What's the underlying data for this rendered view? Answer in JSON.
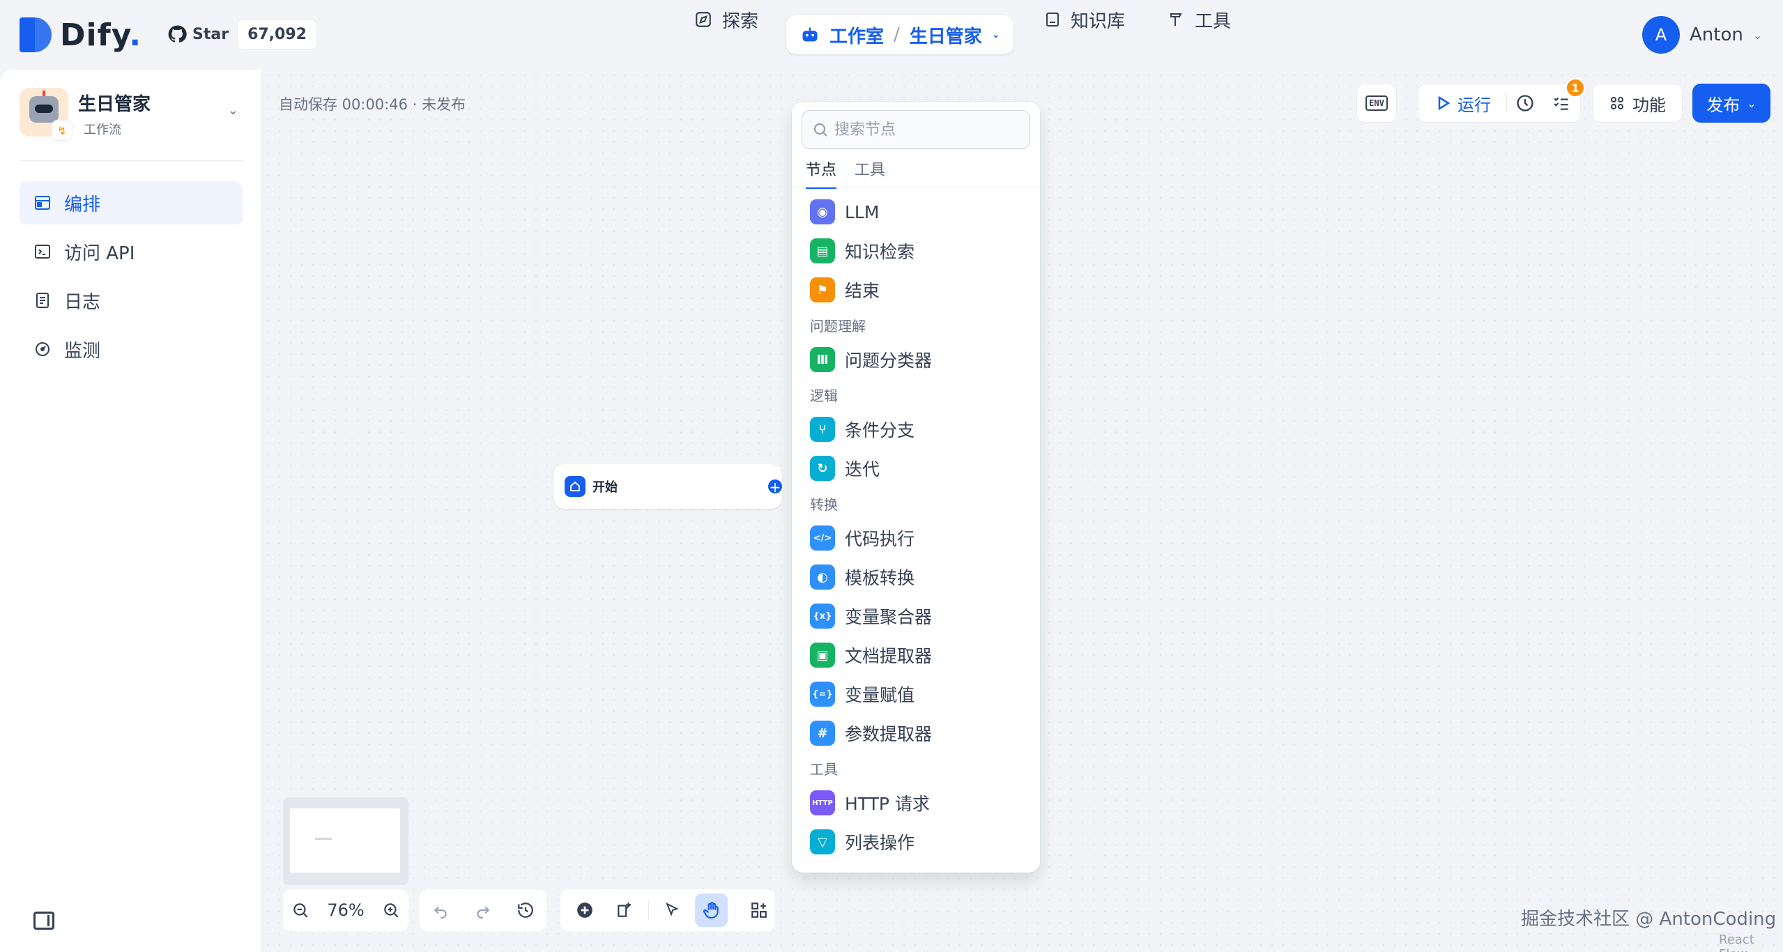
{
  "brand": {
    "name": "Dify",
    "dot": "."
  },
  "github": {
    "star_label": "Star",
    "count": "67,092"
  },
  "nav": {
    "explore": "探索",
    "studio": "工作室",
    "app": "生日管家",
    "datasets": "知识库",
    "tools": "工具"
  },
  "user": {
    "initial": "A",
    "name": "Anton"
  },
  "app": {
    "name": "生日管家",
    "type": "工作流"
  },
  "sidebar": {
    "items": [
      {
        "label": "编排",
        "icon": "layout-icon",
        "active": true
      },
      {
        "label": "访问 API",
        "icon": "terminal-icon",
        "active": false
      },
      {
        "label": "日志",
        "icon": "file-list-icon",
        "active": false
      },
      {
        "label": "监测",
        "icon": "gauge-icon",
        "active": false
      }
    ]
  },
  "canvas": {
    "autosave": "自动保存 00:00:46 · 未发布",
    "start_node": "开始",
    "zoom": "76%"
  },
  "actions": {
    "env": "ENV",
    "run": "运行",
    "badge": "1",
    "features": "功能",
    "publish": "发布"
  },
  "picker": {
    "search_placeholder": "搜索节点",
    "tabs": [
      "节点",
      "工具"
    ],
    "entries": [
      {
        "kind": "item",
        "label": "LLM",
        "color": "#6172f3",
        "glyph": "◉"
      },
      {
        "kind": "item",
        "label": "知识检索",
        "color": "#16b364",
        "glyph": "▤"
      },
      {
        "kind": "item",
        "label": "结束",
        "color": "#f79009",
        "glyph": "⚑"
      },
      {
        "kind": "group",
        "label": "问题理解"
      },
      {
        "kind": "item",
        "label": "问题分类器",
        "color": "#16b364",
        "glyph": "Ⅲ"
      },
      {
        "kind": "group",
        "label": "逻辑"
      },
      {
        "kind": "item",
        "label": "条件分支",
        "color": "#06aed4",
        "glyph": "⑂"
      },
      {
        "kind": "item",
        "label": "迭代",
        "color": "#06aed4",
        "glyph": "↻"
      },
      {
        "kind": "group",
        "label": "转换"
      },
      {
        "kind": "item",
        "label": "代码执行",
        "color": "#2e90fa",
        "glyph": "</>"
      },
      {
        "kind": "item",
        "label": "模板转换",
        "color": "#2e90fa",
        "glyph": "◐"
      },
      {
        "kind": "item",
        "label": "变量聚合器",
        "color": "#2e90fa",
        "glyph": "{x}"
      },
      {
        "kind": "item",
        "label": "文档提取器",
        "color": "#16b364",
        "glyph": "▣"
      },
      {
        "kind": "item",
        "label": "变量赋值",
        "color": "#2e90fa",
        "glyph": "{=}"
      },
      {
        "kind": "item",
        "label": "参数提取器",
        "color": "#2e90fa",
        "glyph": "#"
      },
      {
        "kind": "group",
        "label": "工具"
      },
      {
        "kind": "item",
        "label": "HTTP 请求",
        "color": "#7a5af8",
        "glyph": "HTTP"
      },
      {
        "kind": "item",
        "label": "列表操作",
        "color": "#06aed4",
        "glyph": "▽"
      }
    ]
  },
  "footer": {
    "watermark": "掘金技术社区 @ AntonCoding",
    "reactflow": "React Flow"
  },
  "colors": {
    "accent": "#155eef",
    "background": "#f2f4f7"
  }
}
